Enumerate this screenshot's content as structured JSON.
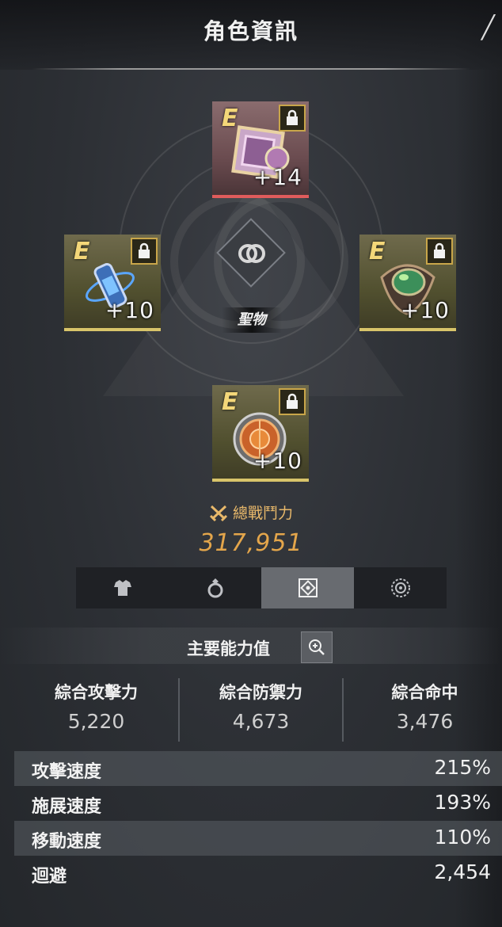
{
  "header": {
    "title": "角色資訊"
  },
  "slots": {
    "top": {
      "grade": "E",
      "enhancement": "+14"
    },
    "left": {
      "grade": "E",
      "enhancement": "+10"
    },
    "right": {
      "grade": "E",
      "enhancement": "+10"
    },
    "bottom": {
      "grade": "E",
      "enhancement": "+10"
    }
  },
  "relic": {
    "label": "聖物"
  },
  "power": {
    "label": "總戰鬥力",
    "value": "317,951"
  },
  "tabs": [
    {
      "icon": "armor-icon",
      "active": false
    },
    {
      "icon": "ring-icon",
      "active": false
    },
    {
      "icon": "relic-icon",
      "active": true
    },
    {
      "icon": "gear-badge-icon",
      "active": false
    }
  ],
  "stats": {
    "title": "主要能力值",
    "main": [
      {
        "label": "綜合攻擊力",
        "value": "5,220"
      },
      {
        "label": "綜合防禦力",
        "value": "4,673"
      },
      {
        "label": "綜合命中",
        "value": "3,476"
      }
    ],
    "rows": [
      {
        "label": "攻擊速度",
        "value": "215%"
      },
      {
        "label": "施展速度",
        "value": "193%"
      },
      {
        "label": "移動速度",
        "value": "110%"
      },
      {
        "label": "迴避",
        "value": "2,454"
      }
    ]
  },
  "colors": {
    "accent_gold": "#e4a64b",
    "slot_gold": "#d8c46a",
    "slot_red": "#e05c5c"
  }
}
